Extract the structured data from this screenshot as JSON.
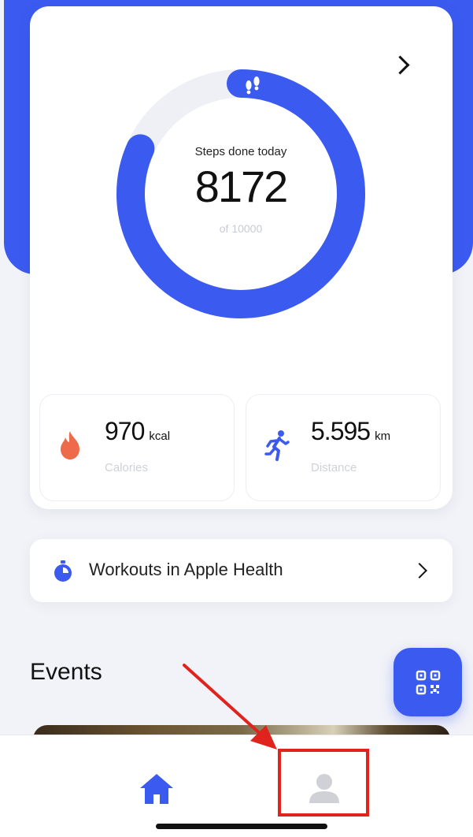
{
  "steps": {
    "title": "Steps done today",
    "count": "8172",
    "goal_text": "of 10000",
    "progress": 0.8172
  },
  "stats": {
    "calories": {
      "value": "970",
      "unit": "kcal",
      "label": "Calories",
      "icon": "flame-icon"
    },
    "distance": {
      "value": "5.595",
      "unit": "km",
      "label": "Distance",
      "icon": "running-person-icon"
    }
  },
  "workouts": {
    "label": "Workouts in Apple Health",
    "icon": "stopwatch-icon"
  },
  "events": {
    "title": "Events"
  },
  "tabbar": {
    "items": [
      "home-icon",
      "profile-icon"
    ],
    "active": "home"
  },
  "colors": {
    "accent": "#3b5bf0",
    "flame": "#ee6a4b",
    "annotation": "#e0231d"
  }
}
